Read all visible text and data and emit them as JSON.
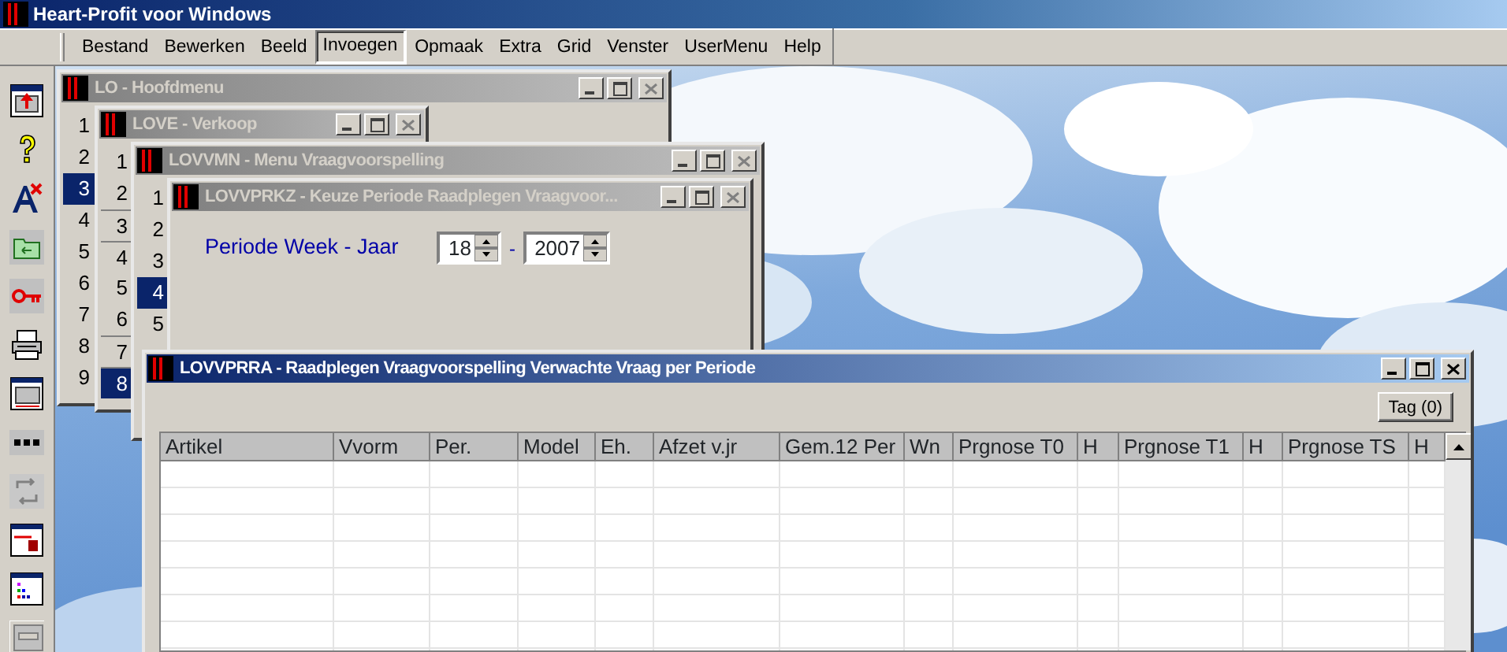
{
  "app": {
    "title": "Heart-Profit voor Windows"
  },
  "menu": [
    {
      "label": "Bestand",
      "selected": false
    },
    {
      "label": "Bewerken",
      "selected": false
    },
    {
      "label": "Beeld",
      "selected": false
    },
    {
      "label": "Invoegen",
      "selected": true
    },
    {
      "label": "Opmaak",
      "selected": false
    },
    {
      "label": "Extra",
      "selected": false
    },
    {
      "label": "Grid",
      "selected": false
    },
    {
      "label": "Venster",
      "selected": false
    },
    {
      "label": "UserMenu",
      "selected": false
    },
    {
      "label": "Help",
      "selected": false
    }
  ],
  "windows": [
    {
      "kind": "menu",
      "title": "LO - Hoofdmenu",
      "active": false,
      "items": [
        {
          "label": "1",
          "selected": false
        },
        {
          "label": "2",
          "selected": false
        },
        {
          "label": "3",
          "selected": true
        },
        {
          "label": "4",
          "selected": false
        },
        {
          "label": "5",
          "selected": false
        },
        {
          "label": "6",
          "selected": false
        },
        {
          "label": "7",
          "selected": false
        },
        {
          "label": "8",
          "selected": false
        },
        {
          "label": "9",
          "selected": false
        }
      ]
    },
    {
      "kind": "menu",
      "title": "LOVE - Verkoop",
      "active": false,
      "items": [
        {
          "label": "1",
          "selected": false,
          "divider_above": false
        },
        {
          "label": "2",
          "selected": false,
          "divider_above": false
        },
        {
          "label": "3",
          "selected": false,
          "divider_above": true
        },
        {
          "label": "4",
          "selected": false,
          "divider_above": true
        },
        {
          "label": "5",
          "selected": false,
          "divider_above": false
        },
        {
          "label": "6",
          "selected": false,
          "divider_above": false
        },
        {
          "label": "7",
          "selected": false,
          "divider_above": true
        },
        {
          "label": "8",
          "selected": true,
          "divider_above": true
        }
      ]
    },
    {
      "kind": "menu",
      "title": "LOVVMN - Menu Vraagvoorspelling",
      "active": false,
      "items": [
        {
          "label": "1",
          "selected": false
        },
        {
          "label": "2",
          "selected": false
        },
        {
          "label": "3",
          "selected": false
        },
        {
          "label": "4",
          "selected": true
        },
        {
          "label": "5",
          "selected": false
        }
      ]
    },
    {
      "kind": "form",
      "title": "LOVVPRKZ - Keuze Periode Raadplegen Vraagvoor...",
      "active": false,
      "label": "Periode Week - Jaar",
      "week": "18",
      "separator": "-",
      "year": "2007"
    },
    {
      "kind": "grid",
      "title": "LOVVPRRA - Raadplegen Vraagvoorspelling Verwachte Vraag per Periode",
      "active": true,
      "button": "Tag (0)",
      "columns": [
        "Artikel",
        "Vvorm",
        "Per.",
        "Model",
        "Eh.",
        "Afzet v.jr",
        "Gem.12 Per",
        "Wn",
        "Prgnose T0",
        "H",
        "Prgnose T1",
        "H",
        "Prgnose TS",
        "H"
      ]
    }
  ]
}
